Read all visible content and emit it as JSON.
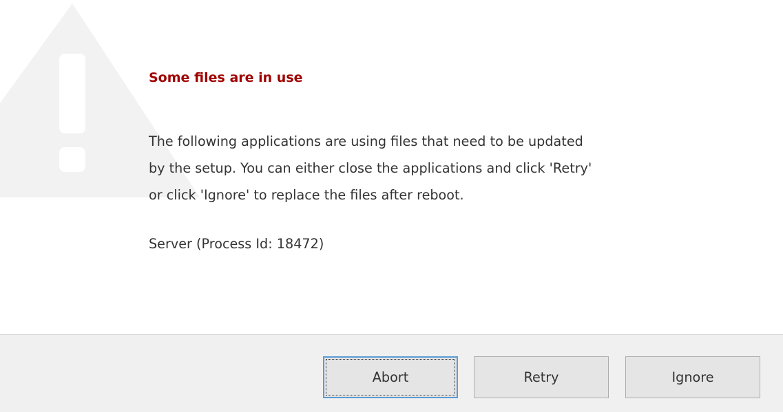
{
  "dialog": {
    "title": "Some files are in use",
    "message_lines": [
      "The following applications are using files that need to be updated",
      "by the setup. You can either close the applications and click 'Retry'",
      "or click 'Ignore' to replace the files after reboot."
    ],
    "processes": [
      "Server (Process Id: 18472)"
    ],
    "watermark_icon": "warning-icon"
  },
  "buttons": {
    "abort": "Abort",
    "retry": "Retry",
    "ignore": "Ignore"
  },
  "colors": {
    "title": "#a00000",
    "text": "#333333",
    "footer_bg": "#f0f0f0",
    "button_bg": "#e5e5e5",
    "focus_border": "#5b9bd5",
    "watermark": "#f2f2f2"
  }
}
